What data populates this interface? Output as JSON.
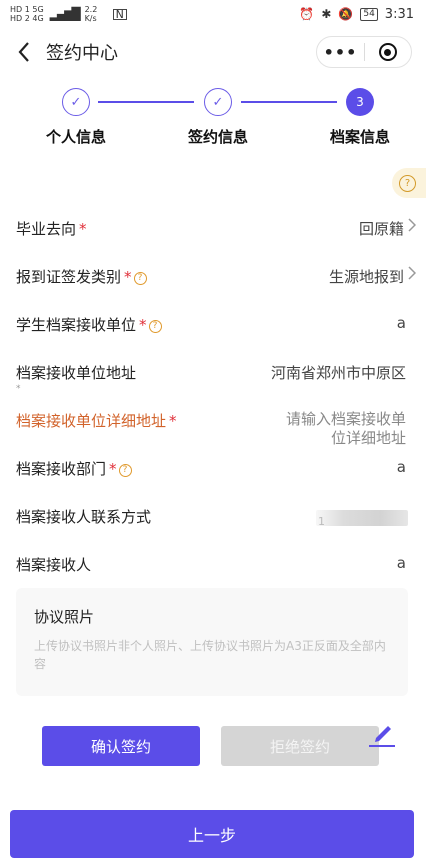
{
  "status_bar": {
    "left_top": "HD 1  5G",
    "left_bottom": "HD 2  4G",
    "speed": "2.2 K/s",
    "nfc": "N",
    "battery": "54",
    "time": "3:31"
  },
  "nav": {
    "title": "签约中心",
    "more": "•••"
  },
  "steps": [
    {
      "label": "个人信息",
      "state": "done",
      "mark": "✓"
    },
    {
      "label": "签约信息",
      "state": "done",
      "mark": "✓"
    },
    {
      "label": "档案信息",
      "state": "active",
      "mark": "3"
    }
  ],
  "help_icon": "?",
  "form": {
    "destination": {
      "label": "毕业去向",
      "required": "*",
      "value": "回原籍"
    },
    "report_type": {
      "label": "报到证签发类别",
      "required": "*",
      "tip": "?",
      "value": "生源地报到"
    },
    "archive_unit": {
      "label": "学生档案接收单位",
      "required": "*",
      "tip": "?",
      "value": "a"
    },
    "unit_address": {
      "label": "档案接收单位地址",
      "required": "*",
      "value": "河南省郑州市中原区"
    },
    "detail_address": {
      "label": "档案接收单位详细地址",
      "required": "*",
      "placeholder": "请输入档案接收单位详细地址"
    },
    "department": {
      "label": "档案接收部门",
      "required": "*",
      "tip": "?",
      "value": "a"
    },
    "contact": {
      "label": "档案接收人联系方式",
      "value": "1"
    },
    "receiver": {
      "label": "档案接收人",
      "value": "a"
    }
  },
  "photo": {
    "title": "协议照片",
    "hint": "上传协议书照片非个人照片、上传协议书照片为A3正反面及全部内容"
  },
  "buttons": {
    "confirm": "确认签约",
    "reject": "拒绝签约",
    "prev": "上一步"
  },
  "colors": {
    "primary": "#5b4de8",
    "required": "#e0303a",
    "warning_label": "#d2632b",
    "tip": "#e09a2e",
    "disabled": "#d5d5d5"
  }
}
